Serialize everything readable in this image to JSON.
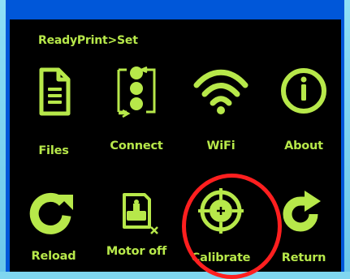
{
  "breadcrumb": "ReadyPrint>Set",
  "tiles": [
    {
      "label": "Files",
      "icon": "file-icon"
    },
    {
      "label": "Connect",
      "icon": "connect-icon"
    },
    {
      "label": "WiFi",
      "icon": "wifi-icon"
    },
    {
      "label": "About",
      "icon": "info-icon"
    },
    {
      "label": "Reload",
      "icon": "reload-icon"
    },
    {
      "label": "Motor off",
      "icon": "motor-off-icon"
    },
    {
      "label": "Calibrate",
      "icon": "calibrate-icon"
    },
    {
      "label": "Return",
      "icon": "return-icon"
    }
  ],
  "colors": {
    "accent": "#b7e84a",
    "screen": "#000000",
    "frame": "#0057d9",
    "highlight": "#ff1f1f"
  }
}
